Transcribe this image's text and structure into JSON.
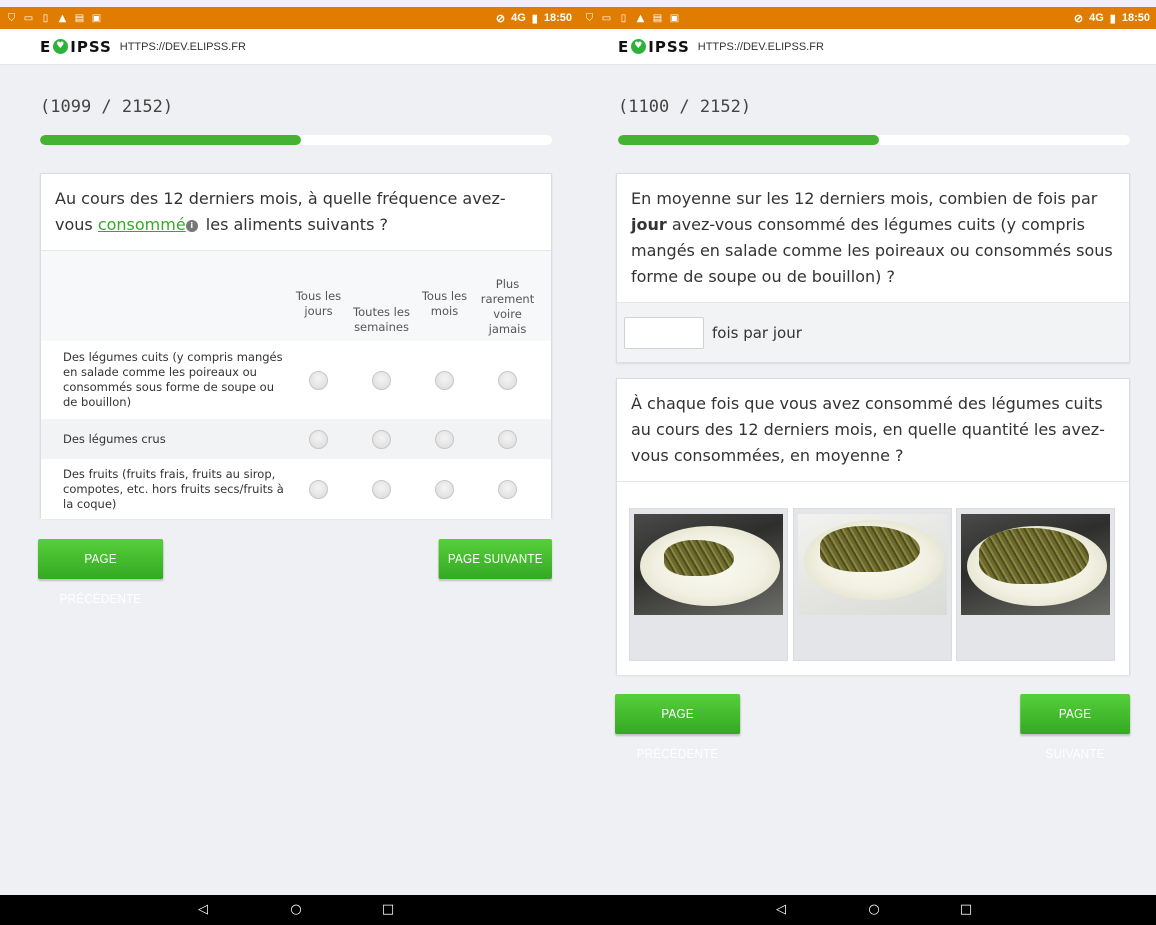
{
  "status_bar": {
    "left_icons": [
      "shield-icon",
      "message-icon",
      "sim-icon",
      "warning-icon",
      "chat-icon",
      "image-icon"
    ],
    "network": "4G",
    "time": "18:50"
  },
  "brand": {
    "logo_left": "E",
    "logo_right": "IPSS",
    "url": "HTTPS://DEV.ELIPSS.FR"
  },
  "left": {
    "counter": "(1099 / 2152)",
    "progress": 0.51,
    "question": {
      "before_link": "Au cours des 12 derniers mois, à quelle fréquence avez-vous ",
      "link": "consommé",
      "after_link": " les aliments suivants ?"
    },
    "columns": [
      "Tous les jours",
      "Toutes les semaines",
      "Tous les mois",
      "Plus rarement voire jamais"
    ],
    "rows": [
      "Des légumes cuits (y compris mangés en salade comme les poireaux ou consommés sous forme de soupe ou de bouillon)",
      "Des légumes crus",
      "Des fruits (fruits frais, fruits au sirop, compotes, etc. hors fruits secs/fruits à la coque)"
    ],
    "prev_button": "PAGE PRÉCÉDENTE",
    "next_button": "PAGE SUIVANTE"
  },
  "right": {
    "counter": "(1100 / 2152)",
    "progress": 0.51,
    "q1": {
      "before_bold": "En moyenne sur les 12 derniers mois, combien de fois par ",
      "bold": "jour",
      "after_bold": " avez-vous consommé des légumes cuits (y compris mangés en salade comme les poireaux ou consommés sous forme de soupe ou de bouillon) ?"
    },
    "input_value": "",
    "input_suffix": "fois par jour",
    "q2": "À chaque fois que vous avez consommé des légumes cuits au cours des 12 derniers mois, en quelle quantité les avez-vous consommées, en moyenne ?",
    "portion_images": [
      "portion-small",
      "portion-medium",
      "portion-large"
    ],
    "prev_button": "PAGE PRÉCÉDENTE",
    "next_button": "PAGE SUIVANTE"
  },
  "nav": {
    "back": "◁",
    "home": "○",
    "recents": "□"
  }
}
